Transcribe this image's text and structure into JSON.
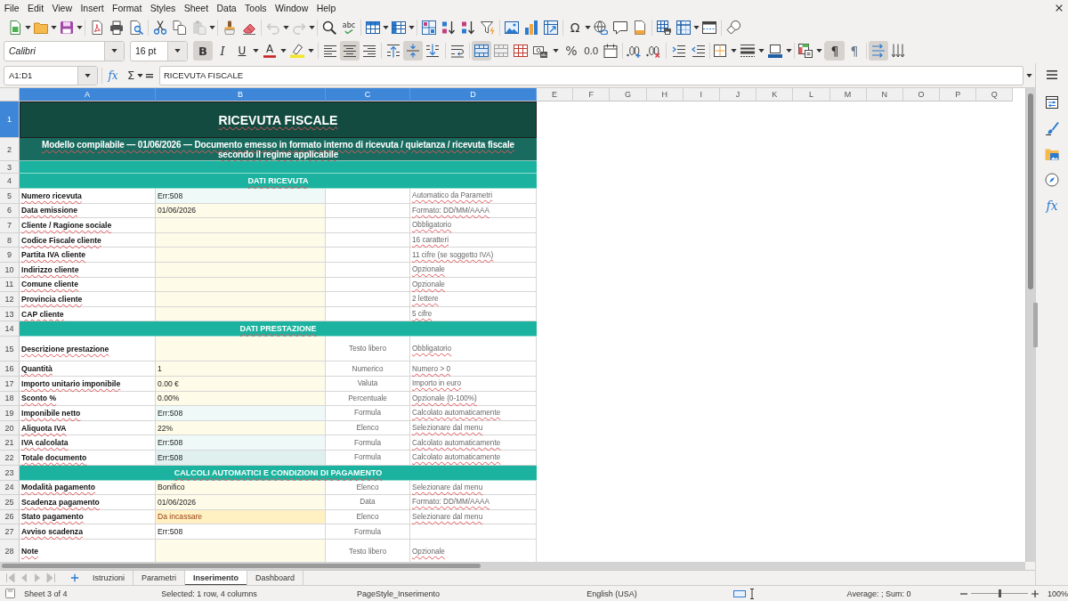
{
  "menu": [
    "File",
    "Edit",
    "View",
    "Insert",
    "Format",
    "Styles",
    "Sheet",
    "Data",
    "Tools",
    "Window",
    "Help"
  ],
  "standard_toolbar": {
    "paste": {
      "disabled": true
    },
    "undo": {
      "disabled": true
    },
    "redo": {
      "disabled": true
    },
    "spelling": {
      "label": "abc"
    },
    "special_character": {
      "label": "Ω"
    }
  },
  "formatting_toolbar": {
    "font_name": "Calibri",
    "font_size": "16 pt",
    "bold": {
      "label": "B",
      "on": true
    },
    "italic": {
      "label": "I",
      "on": false
    },
    "underline": {
      "label": "U",
      "on": false
    },
    "font_color": {
      "label": "A"
    },
    "align_left": {
      "on": false
    },
    "align_center": {
      "on": true
    },
    "align_right": {
      "on": false
    },
    "align_top": {
      "on": false
    },
    "align_middle": {
      "on": true
    },
    "align_bottom": {
      "on": false
    },
    "wrap_text": {
      "on": false
    },
    "merge_and_center": {
      "on": true
    },
    "percent": {
      "label": "%"
    },
    "number": {
      "label": "0.0"
    },
    "left_to_right": {
      "label": "¶",
      "on": true
    },
    "right_to_left": {
      "label": "¶",
      "on": false
    },
    "text_left_to_right": {
      "on": true
    },
    "text_top_to_bottom": {
      "on": false
    }
  },
  "formula_bar": {
    "name_box": "A1:D1",
    "function_wizard": "fx",
    "sum": "Σ",
    "equals": "=",
    "content": "RICEVUTA FISCALE"
  },
  "sheet": {
    "columns": [
      {
        "label": "A",
        "selected": true
      },
      {
        "label": "B",
        "selected": true
      },
      {
        "label": "C",
        "selected": true
      },
      {
        "label": "D",
        "selected": true
      },
      {
        "label": "E",
        "selected": false
      },
      {
        "label": "F",
        "selected": false
      },
      {
        "label": "G",
        "selected": false
      },
      {
        "label": "H",
        "selected": false
      },
      {
        "label": "I",
        "selected": false
      },
      {
        "label": "J",
        "selected": false
      },
      {
        "label": "K",
        "selected": false
      },
      {
        "label": "L",
        "selected": false
      },
      {
        "label": "M",
        "selected": false
      },
      {
        "label": "N",
        "selected": false
      },
      {
        "label": "O",
        "selected": false
      },
      {
        "label": "P",
        "selected": false
      },
      {
        "label": "Q",
        "selected": false
      }
    ],
    "rows": [
      {
        "number": "1",
        "selected": true,
        "kind": "title",
        "text": "RICEVUTA FISCALE"
      },
      {
        "number": "2",
        "selected": false,
        "kind": "subtitle",
        "text": "Modello compilabile — 01/06/2026 — Documento emesso in formato interno di ricevuta / quietanza / ricevuta fiscale secondo il regime applicabile"
      },
      {
        "number": "3",
        "selected": false,
        "kind": "band"
      },
      {
        "number": "4",
        "selected": false,
        "kind": "section",
        "text": "DATI RICEVUTA"
      },
      {
        "number": "5",
        "selected": false,
        "kind": "formula",
        "multiline": false,
        "label": "Numero ricevuta",
        "value": "Err:508",
        "note": "Automatico da Parametri"
      },
      {
        "number": "6",
        "selected": false,
        "kind": "input",
        "multiline": false,
        "label": "Data emissione",
        "value": "01/06/2026",
        "note": "Formato: DD/MM/AAAA"
      },
      {
        "number": "7",
        "selected": false,
        "kind": "input",
        "multiline": false,
        "label": "Cliente / Ragione sociale",
        "note": "Obbligatorio"
      },
      {
        "number": "8",
        "selected": false,
        "kind": "input",
        "multiline": false,
        "label": "Codice Fiscale cliente",
        "note": "16 caratteri"
      },
      {
        "number": "9",
        "selected": false,
        "kind": "input",
        "multiline": false,
        "label": "Partita IVA cliente",
        "note": "11 cifre (se soggetto IVA)"
      },
      {
        "number": "10",
        "selected": false,
        "kind": "input",
        "multiline": false,
        "label": "Indirizzo cliente",
        "note": "Opzionale"
      },
      {
        "number": "11",
        "selected": false,
        "kind": "input",
        "multiline": false,
        "label": "Comune cliente",
        "note": "Opzionale"
      },
      {
        "number": "12",
        "selected": false,
        "kind": "input",
        "multiline": false,
        "label": "Provincia cliente",
        "note": "2 lettere"
      },
      {
        "number": "13",
        "selected": false,
        "kind": "input",
        "multiline": false,
        "label": "CAP cliente",
        "note": "5 cifre"
      },
      {
        "number": "14",
        "selected": false,
        "kind": "section",
        "text": "DATI PRESTAZIONE"
      },
      {
        "number": "15",
        "selected": false,
        "kind": "input",
        "multiline": true,
        "label": "Descrizione prestazione",
        "type": "Testo libero",
        "note": "Obbligatorio"
      },
      {
        "number": "16",
        "selected": false,
        "kind": "input",
        "multiline": false,
        "label": "Quantità",
        "value": "1",
        "type": "Numerico",
        "note": "Numero > 0"
      },
      {
        "number": "17",
        "selected": false,
        "kind": "input",
        "multiline": false,
        "label": "Importo unitario imponibile",
        "value": "0.00 €",
        "type": "Valuta",
        "note": "Importo in euro"
      },
      {
        "number": "18",
        "selected": false,
        "kind": "input",
        "multiline": false,
        "label": "Sconto %",
        "value": "0.00%",
        "type": "Percentuale",
        "note": "Opzionale (0-100%)"
      },
      {
        "number": "19",
        "selected": false,
        "kind": "formula",
        "multiline": false,
        "label": "Imponibile netto",
        "value": "Err:508",
        "type": "Formula",
        "note": "Calcolato automaticamente"
      },
      {
        "number": "20",
        "selected": false,
        "kind": "input",
        "multiline": false,
        "label": "Aliquota IVA",
        "value": "22%",
        "type": "Elenco",
        "note": "Selezionare dal menu"
      },
      {
        "number": "21",
        "selected": false,
        "kind": "formula",
        "multiline": false,
        "label": "IVA calcolata",
        "value": "Err:508",
        "type": "Formula",
        "note": "Calcolato automaticamente"
      },
      {
        "number": "22",
        "selected": false,
        "kind": "total",
        "multiline": false,
        "label": "Totale documento",
        "value": "Err:508",
        "type": "Formula",
        "note": "Calcolato automaticamente"
      },
      {
        "number": "23",
        "selected": false,
        "kind": "section",
        "text": "CALCOLI AUTOMATICI E CONDIZIONI DI PAGAMENTO"
      },
      {
        "number": "24",
        "selected": false,
        "kind": "input",
        "multiline": false,
        "label": "Modalità pagamento",
        "value": "Bonifico",
        "type": "Elenco",
        "note": "Selezionare dal menu"
      },
      {
        "number": "25",
        "selected": false,
        "kind": "input",
        "multiline": false,
        "label": "Scadenza pagamento",
        "value": "01/06/2026",
        "type": "Data",
        "note": "Formato: DD/MM/AAAA"
      },
      {
        "number": "26",
        "selected": false,
        "kind": "status",
        "multiline": false,
        "label": "Stato pagamento",
        "value": "Da incassare",
        "type": "Elenco",
        "note": "Selezionare dal menu"
      },
      {
        "number": "27",
        "selected": false,
        "kind": "plain",
        "multiline": false,
        "label": "Avviso scadenza",
        "value": "Err:508",
        "type": "Formula"
      },
      {
        "number": "28",
        "selected": false,
        "kind": "input",
        "multiline": true,
        "label": "Note",
        "type": "Testo libero",
        "note": "Opzionale"
      }
    ]
  },
  "sidebar": {
    "functions": "fx"
  },
  "sheet_tabs": [
    {
      "label": "Istruzioni",
      "selected": false
    },
    {
      "label": "Parametri",
      "selected": false
    },
    {
      "label": "Inserimento",
      "selected": true
    },
    {
      "label": "Dashboard",
      "selected": false
    }
  ],
  "status_bar": {
    "sheet": "Sheet 3 of 4",
    "selection": "Selected: 1 row, 4 columns",
    "page_style": "PageStyle_Inserimento",
    "language": "English (USA)",
    "sum": "Average: ; Sum: 0",
    "zoom": {
      "level": 0.5,
      "reading": "100%"
    }
  }
}
